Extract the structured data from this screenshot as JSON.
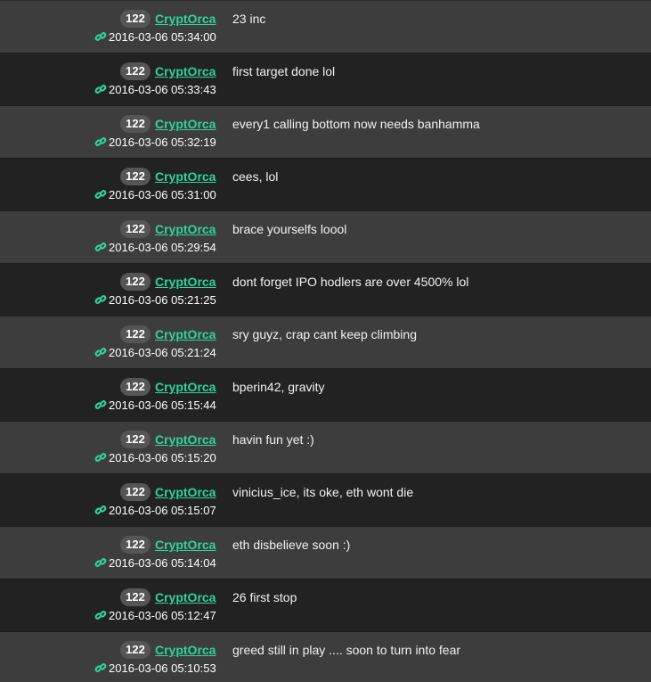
{
  "colors": {
    "row_light": "#3d3d3d",
    "row_dark": "#222222",
    "username": "#2fd49a",
    "badge_bg": "#555555",
    "text": "#f2f2f2"
  },
  "icons": {
    "permalink": "link-icon"
  },
  "messages": [
    {
      "rep": "122",
      "user": "CryptOrca",
      "time": "2016-03-06 05:34:00",
      "text": "23 inc"
    },
    {
      "rep": "122",
      "user": "CryptOrca",
      "time": "2016-03-06 05:33:43",
      "text": "first target done lol"
    },
    {
      "rep": "122",
      "user": "CryptOrca",
      "time": "2016-03-06 05:32:19",
      "text": "every1 calling bottom now needs banhamma"
    },
    {
      "rep": "122",
      "user": "CryptOrca",
      "time": "2016-03-06 05:31:00",
      "text": "cees, lol"
    },
    {
      "rep": "122",
      "user": "CryptOrca",
      "time": "2016-03-06 05:29:54",
      "text": "brace yourselfs loool"
    },
    {
      "rep": "122",
      "user": "CryptOrca",
      "time": "2016-03-06 05:21:25",
      "text": "dont forget IPO hodlers are over 4500% lol"
    },
    {
      "rep": "122",
      "user": "CryptOrca",
      "time": "2016-03-06 05:21:24",
      "text": "sry guyz, crap cant keep climbing"
    },
    {
      "rep": "122",
      "user": "CryptOrca",
      "time": "2016-03-06 05:15:44",
      "text": "bperin42, gravity"
    },
    {
      "rep": "122",
      "user": "CryptOrca",
      "time": "2016-03-06 05:15:20",
      "text": "havin fun yet :)"
    },
    {
      "rep": "122",
      "user": "CryptOrca",
      "time": "2016-03-06 05:15:07",
      "text": "vinicius_ice, its oke, eth wont die"
    },
    {
      "rep": "122",
      "user": "CryptOrca",
      "time": "2016-03-06 05:14:04",
      "text": "eth disbelieve soon :)"
    },
    {
      "rep": "122",
      "user": "CryptOrca",
      "time": "2016-03-06 05:12:47",
      "text": "26 first stop"
    },
    {
      "rep": "122",
      "user": "CryptOrca",
      "time": "2016-03-06 05:10:53",
      "text": "greed still in play .... soon to turn into fear"
    }
  ]
}
